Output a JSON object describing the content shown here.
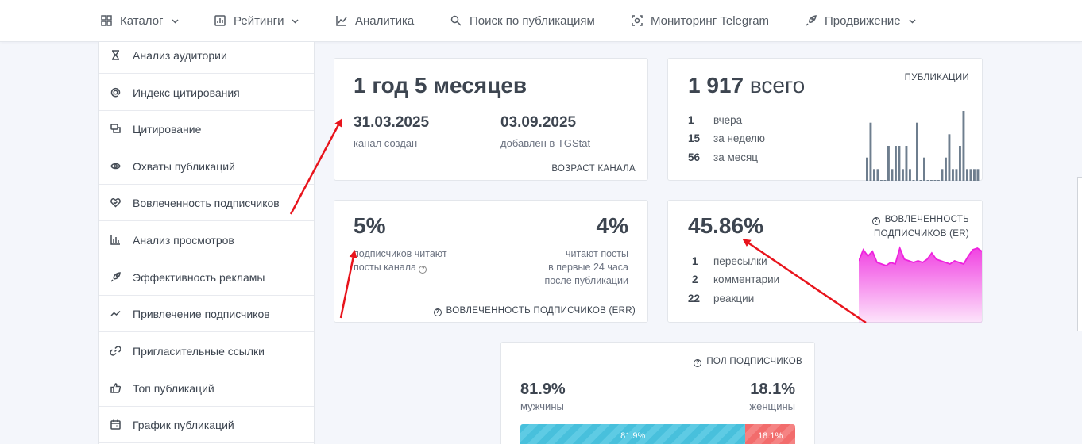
{
  "nav": [
    {
      "label": "Каталог",
      "icon": "grid-icon",
      "dropdown": true
    },
    {
      "label": "Рейтинги",
      "icon": "bar-chart-icon",
      "dropdown": true
    },
    {
      "label": "Аналитика",
      "icon": "line-chart-icon",
      "dropdown": false
    },
    {
      "label": "Поиск по публикациям",
      "icon": "search-icon",
      "dropdown": false
    },
    {
      "label": "Мониторинг Telegram",
      "icon": "scan-icon",
      "dropdown": false
    },
    {
      "label": "Продвижение",
      "icon": "rocket-icon",
      "dropdown": true
    }
  ],
  "sidebar": [
    {
      "label": "Анализ аудитории",
      "icon": "hourglass-icon"
    },
    {
      "label": "Индекс цитирования",
      "icon": "at-icon"
    },
    {
      "label": "Цитирование",
      "icon": "quote-icon"
    },
    {
      "label": "Охваты публикаций",
      "icon": "eye-icon"
    },
    {
      "label": "Вовлеченность подписчиков",
      "icon": "heart-handshake-icon"
    },
    {
      "label": "Анализ просмотров",
      "icon": "bar-chart-icon"
    },
    {
      "label": "Эффективность рекламы",
      "icon": "rocket-icon"
    },
    {
      "label": "Привлечение подписчиков",
      "icon": "trend-icon"
    },
    {
      "label": "Пригласительные ссылки",
      "icon": "link-icon"
    },
    {
      "label": "Топ публикаций",
      "icon": "thumbs-up-icon"
    },
    {
      "label": "График публикаций",
      "icon": "calendar-icon"
    }
  ],
  "age_card": {
    "title": "1 год 5 месяцев",
    "created_date": "31.03.2025",
    "created_label": "канал создан",
    "added_date": "03.09.2025",
    "added_label": "добавлен в TGStat",
    "caption": "ВОЗРАСТ КАНАЛА"
  },
  "posts_card": {
    "total": "1 917",
    "total_suffix": "всего",
    "caption": "ПУБЛИКАЦИИ",
    "stats": [
      {
        "n": "1",
        "label": "вчера"
      },
      {
        "n": "15",
        "label": "за неделю"
      },
      {
        "n": "56",
        "label": "за месяц"
      }
    ],
    "bars": [
      0.4,
      1.0,
      0.2,
      0.2,
      0.0,
      0.0,
      0.6,
      0.2,
      0.6,
      0.6,
      0.2,
      0.6,
      0.2,
      0.0,
      1.0,
      0.0,
      0.4,
      0.0,
      0.0,
      0.0,
      0.0,
      0.2,
      0.4,
      0.8,
      0.2,
      0.2,
      0.6,
      1.2,
      0.2,
      0.2,
      0.2,
      0.2
    ]
  },
  "err_card": {
    "left_value": "5%",
    "left_label_1": "подписчиков читают",
    "left_label_2": "посты канала",
    "right_value": "4%",
    "right_label_1": "читают посты",
    "right_label_2": "в первые 24 часа",
    "right_label_3": "после публикации",
    "caption": "ВОВЛЕЧЕННОСТЬ ПОДПИСЧИКОВ (ERR)"
  },
  "er_card": {
    "value": "45.86%",
    "caption_1": "ВОВЛЕЧЕННОСТЬ",
    "caption_2": "ПОДПИСЧИКОВ (ER)",
    "stats": [
      {
        "n": "1",
        "label": "пересылки"
      },
      {
        "n": "2",
        "label": "комментарии"
      },
      {
        "n": "22",
        "label": "реакции"
      }
    ],
    "chart_color": "#ee22dd",
    "sparkline": [
      0.55,
      0.9,
      0.7,
      0.85,
      0.5,
      0.45,
      0.4,
      0.5,
      0.45,
      0.95,
      0.6,
      0.55,
      0.5,
      0.55,
      0.5,
      0.6,
      0.8,
      0.6,
      0.55,
      0.5,
      0.45,
      0.55,
      0.5,
      0.45,
      0.7,
      0.9,
      0.95,
      0.85
    ]
  },
  "gender_card": {
    "caption": "ПОЛ ПОДПИСЧИКОВ",
    "male_value": "81.9%",
    "male_label": "мужчины",
    "female_value": "18.1%",
    "female_label": "женщины",
    "male_bar_label": "81.9%",
    "female_bar_label": "18.1%",
    "male_fraction": 0.819,
    "male_color": "#48c0dc",
    "female_color": "#f26c6c"
  }
}
